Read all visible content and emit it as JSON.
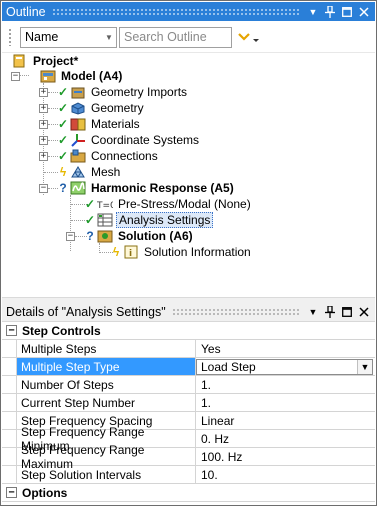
{
  "outline": {
    "title": "Outline",
    "buttons": {
      "dropdown": "▼",
      "pin": "ᛘ",
      "maximize": "□",
      "close": "✕"
    },
    "filter_value": "Name",
    "search_placeholder": "Search Outline"
  },
  "tree": {
    "project": "Project*",
    "model": "Model (A4)",
    "geometry_imports": "Geometry Imports",
    "geometry": "Geometry",
    "materials": "Materials",
    "coordinate_systems": "Coordinate Systems",
    "connections": "Connections",
    "mesh": "Mesh",
    "harmonic_response": "Harmonic Response (A5)",
    "pre_stress": "Pre-Stress/Modal (None)",
    "analysis_settings": "Analysis Settings",
    "solution": "Solution (A6)",
    "solution_information": "Solution Information"
  },
  "details": {
    "title": "Details of \"Analysis Settings\"",
    "buttons": {
      "dropdown": "▼",
      "pin": "ᛘ",
      "maximize": "□",
      "close": "✕"
    },
    "category_step_controls": "Step Controls",
    "category_options": "Options",
    "rows": [
      {
        "name": "Multiple Steps",
        "value": "Yes"
      },
      {
        "name": "Multiple Step Type",
        "value": "Load Step"
      },
      {
        "name": "Number Of Steps",
        "value": "1."
      },
      {
        "name": "Current Step Number",
        "value": "1."
      },
      {
        "name": "Step Frequency Spacing",
        "value": "Linear"
      },
      {
        "name": "Step Frequency Range Minimum",
        "value": "0. Hz"
      },
      {
        "name": "Step Frequency Range Maximum",
        "value": "100. Hz"
      },
      {
        "name": "Step Solution Intervals",
        "value": "10."
      }
    ]
  },
  "colors": {
    "title_bar": "#2a7fd8",
    "selected_row": "#3399ff",
    "status_check": "#1e9a2a"
  }
}
